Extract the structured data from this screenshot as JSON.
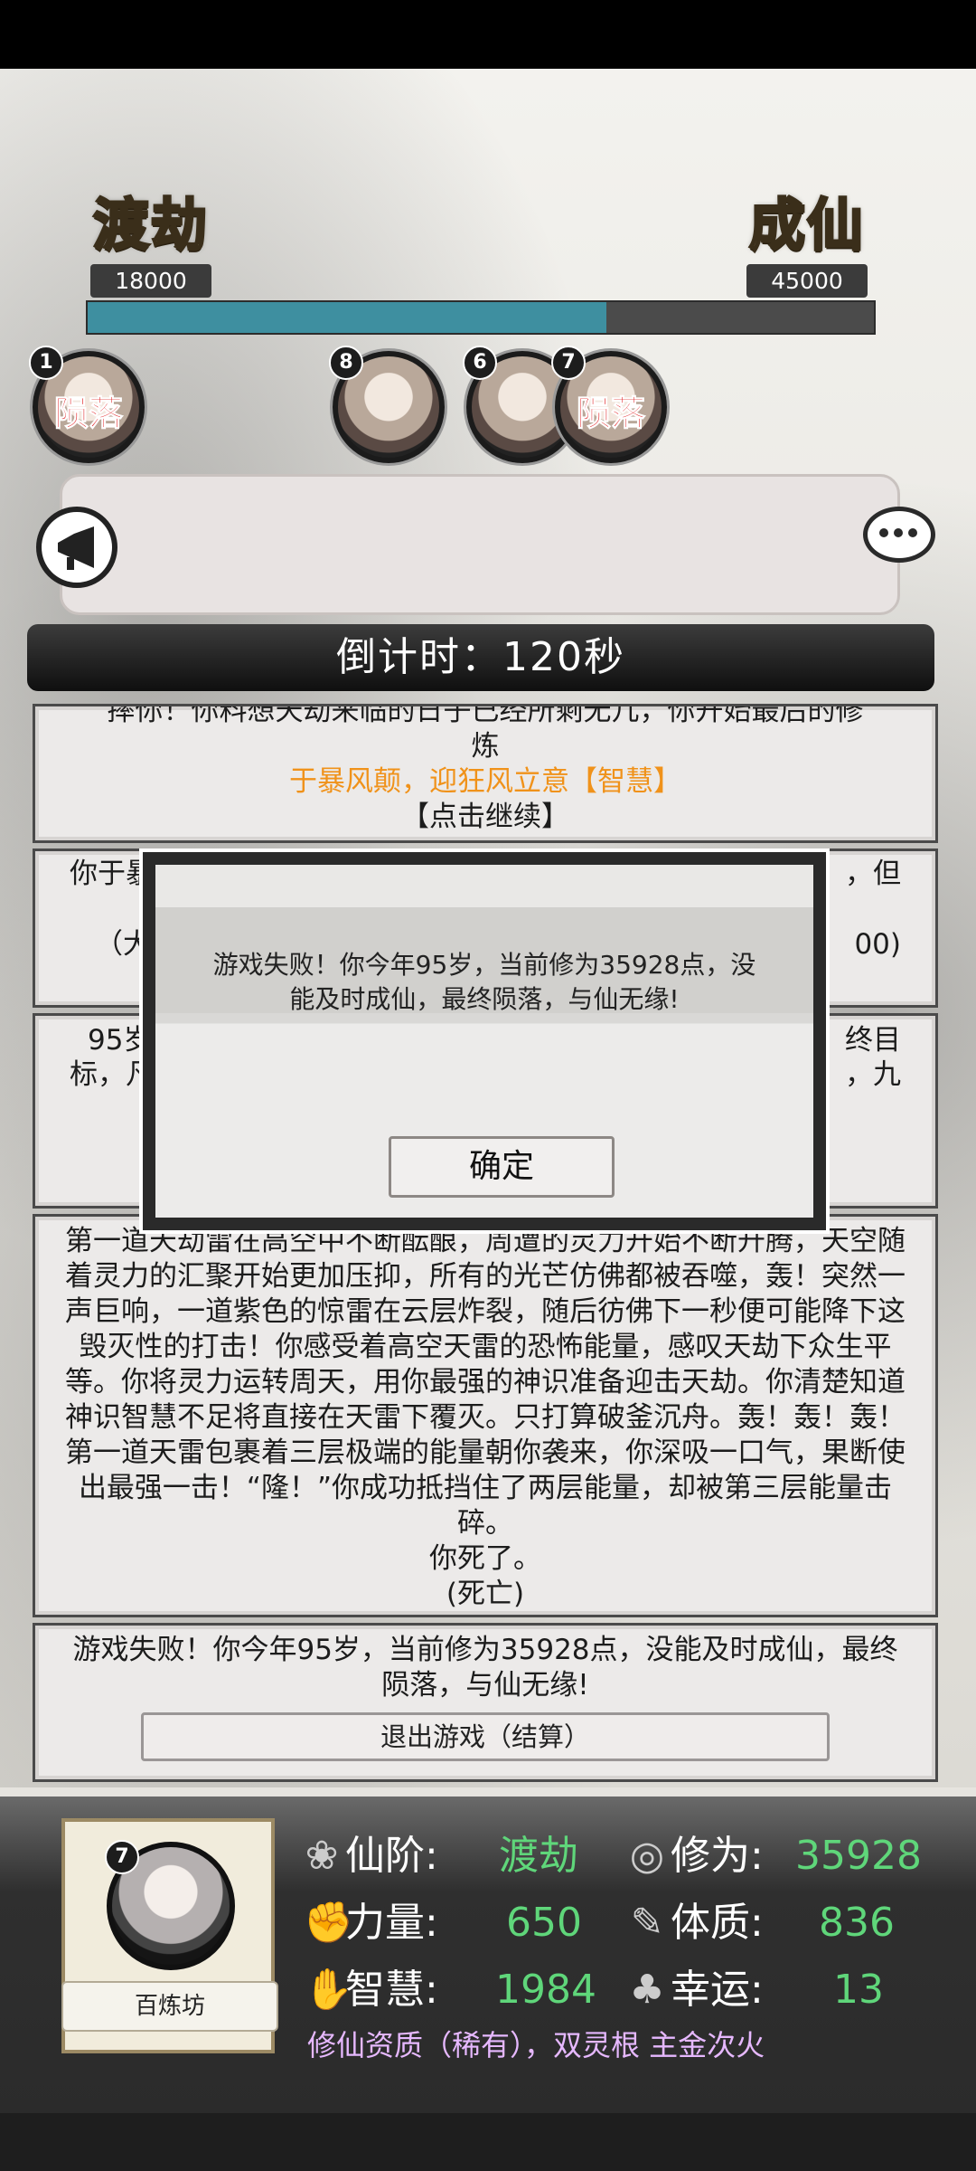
{
  "progress": {
    "left_stage": "渡劫",
    "left_value": "18000",
    "right_stage": "成仙",
    "right_value": "45000",
    "fill_fraction": 0.66
  },
  "avatars": [
    {
      "number": "1",
      "status": "陨落"
    },
    {
      "number": "8",
      "status": ""
    },
    {
      "number": "6",
      "status": ""
    },
    {
      "number": "7",
      "status": "陨落"
    }
  ],
  "countdown": "倒计时：120秒",
  "cards": {
    "card1_line1": "摔你！你料想天劫来临的日子已经所剩无几，你开始最后的修",
    "card1_line2": "炼",
    "card1_choice": "于暴风颠，迎狂风立意【智慧】",
    "card1_continue": "【点击继续】",
    "card2_line1_left": "你于暴",
    "card2_line1_right": "，但",
    "card2_line2_left": "（大",
    "card2_line2_right": "00)",
    "card3_line1_left": "95岁",
    "card3_line1_right": "终目",
    "card3_line2_left": "标，凡",
    "card3_line2_right": "，九",
    "card4_text": "第一道天劫雷在高空中不断酝酿，周遭的灵力开始不断升腾，天空随着灵力的汇聚开始更加压抑，所有的光芒仿佛都被吞噬，轰！突然一声巨响，一道紫色的惊雷在云层炸裂，随后彷佛下一秒便可能降下这毁灭性的打击！你感受着高空天雷的恐怖能量，感叹天劫下众生平等。你将灵力运转周天，用你最强的神识准备迎击天劫。你清楚知道神识智慧不足将直接在天雷下覆灭。只打算破釜沉舟。轰！轰！轰！第一道天雷包裹着三层极端的能量朝你袭来，你深吸一口气，果断使出最强一击！“隆！”你成功抵挡住了两层能量，却被第三层能量击碎。",
    "card4_dead": "你死了。",
    "card4_tag": "(死亡)",
    "card5_text": "游戏失败！你今年95岁，当前修为35928点，没能及时成仙，最终陨落，与仙无缘!",
    "exit_label": "退出游戏（结算）"
  },
  "modal": {
    "message": "游戏失败！你今年95岁，当前修为35928点，没能及时成仙，最终陨落，与仙无缘!",
    "ok_label": "确定"
  },
  "character": {
    "number": "7",
    "shop_label": "百炼坊",
    "stats": {
      "rank_label": "仙阶:",
      "rank_value": "渡劫",
      "cultivation_label": "修为:",
      "cultivation_value": "35928",
      "strength_label": "力量:",
      "strength_value": "650",
      "physique_label": "体质:",
      "physique_value": "836",
      "wisdom_label": "智慧:",
      "wisdom_value": "1984",
      "luck_label": "幸运:",
      "luck_value": "13"
    },
    "aptitude": "修仙资质（稀有），双灵根 主金次火"
  },
  "icons": {
    "horn": "horn-icon",
    "chat": "chat-bubble-icon",
    "rank": "lotus-icon",
    "cultivation": "swirl-icon",
    "strength": "fist-icon",
    "physique": "leg-icon",
    "wisdom": "hand-icon",
    "luck": "clover-icon"
  },
  "colors": {
    "progress_fill": "#3e8fa0",
    "stat_value": "#5fd67a",
    "aptitude": "#e6b8ff",
    "choice": "#f0921a",
    "dead": "#e0181b"
  }
}
